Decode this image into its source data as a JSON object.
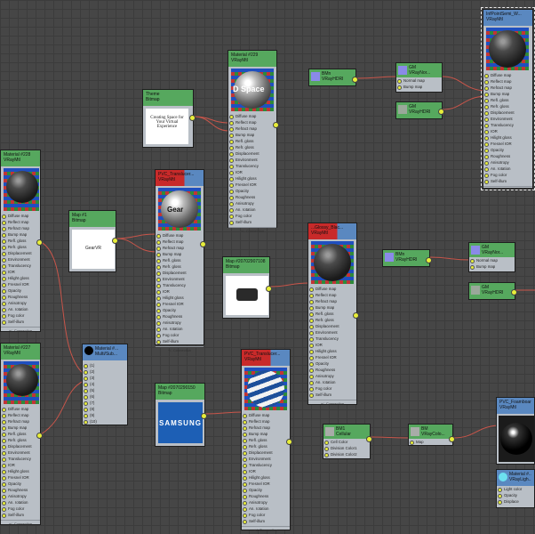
{
  "colors": {
    "canvas": "#464646",
    "header_green": "#56a85e",
    "header_blue": "#5a88c0",
    "header_red": "#c82a2a",
    "port": "#e8ee3a",
    "wire": "#c8554a"
  },
  "slots_full": [
    "Diffuse map",
    "Reflect map",
    "Refract map",
    "Bump map",
    "Refl. gloss",
    "Refr. gloss",
    "Displacement",
    "Environment",
    "Translucency",
    "IOR",
    "Hilight gloss",
    "Fresnel IOR",
    "Opacity",
    "Roughness",
    "Anisotropy",
    "An. rotation",
    "Fog color",
    "Self-illum"
  ],
  "slots_short": [
    "Diffuse map",
    "Reflect map",
    "Refract map",
    "Bump map",
    "Refl. gloss",
    "Refr. gloss",
    "Displacement",
    "Environment",
    "Translucency",
    "IOR",
    "Hilight gloss",
    "Fresnel IOR",
    "Opacity",
    "Roughness",
    "Anisotropy",
    "An. rotation",
    "Fog color"
  ],
  "footer": "+/- Connection",
  "nodes": {
    "mat229": {
      "title": "Material #229",
      "type": "VRayMtl",
      "tex": "D Space"
    },
    "theme": {
      "title": "Theme",
      "type": "Bitmap",
      "text": "Creating Space for Your Virtual Experience"
    },
    "mat228": {
      "title": "Material #228",
      "type": "VRayMtl"
    },
    "map1": {
      "title": "Map #1",
      "type": "Bitmap",
      "text": "GearVR"
    },
    "pvc1": {
      "title": "PVC_Translucer...",
      "type": "VRayMtl",
      "tex": "Gear"
    },
    "map20": {
      "title": "Map #20702907108",
      "type": "Bitmap"
    },
    "dark": {
      "title": "...Glossy_Blac...",
      "type": "VRayMtl"
    },
    "mat227": {
      "title": "Material #227",
      "type": "VRayMtl"
    },
    "multi": {
      "title": "Material #...",
      "type": "Multi/Sub...",
      "slots": [
        "(1)",
        "(2)",
        "(3)",
        "(4)",
        "(5)",
        "(6)",
        "(7)",
        "(8)",
        "(9)",
        "(10)"
      ]
    },
    "map150": {
      "title": "Map #2070290150",
      "type": "Bitmap",
      "text": "SAMSUNG"
    },
    "pvc2": {
      "title": "PVC_Translucer...",
      "type": "VRayMtl"
    },
    "bm_a": {
      "title": "BMn",
      "type": "VRayHDRI"
    },
    "gm_nor": {
      "title": "GM",
      "type": "VRayNor...",
      "slots": [
        "Normal map",
        "Bump map"
      ]
    },
    "gm_hdri": {
      "title": "GM",
      "type": "VRayHDRI"
    },
    "infpoint": {
      "title": "InfPointSemi_W...",
      "type": "VRayMtl"
    },
    "bm_b": {
      "title": "BMn",
      "type": "VRayHDRI"
    },
    "gm_nor2": {
      "title": "GM",
      "type": "VRayNor...",
      "slots": [
        "Normal map",
        "Bump map"
      ]
    },
    "gm_hdri2": {
      "title": "GM",
      "type": "VRayHDRI"
    },
    "bm1": {
      "title": "BM1",
      "type": "Cellular",
      "slots": [
        "Cell Color",
        "Division Color1",
        "Division Color2"
      ]
    },
    "bm_col": {
      "title": "BM",
      "type": "VRayColo...",
      "slots": [
        "Map"
      ]
    },
    "pvc_foam": {
      "title": "PVC_Foamboar...",
      "type": "VRayMtl"
    },
    "light": {
      "title": "Material #...",
      "type": "VRayLigh...",
      "slots": [
        "Light color",
        "Opacity",
        "Displace"
      ]
    }
  }
}
